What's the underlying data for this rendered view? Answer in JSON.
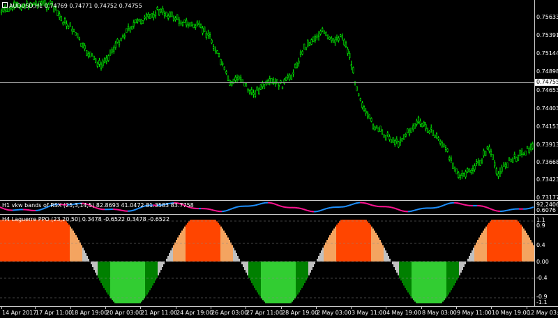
{
  "main_pane": {
    "symbol_title": "AUDUSD,H1",
    "ohlc": "0.74769 0.74771 0.74752 0.74755",
    "price_labels": [
      "0.75633",
      "0.75391",
      "0.75144",
      "0.74898",
      "0.74653",
      "0.74403",
      "0.74153",
      "0.73913",
      "0.73668",
      "0.73423",
      "0.73177"
    ],
    "current_price": "0.74755",
    "candle_color": "#00ff00"
  },
  "rsx_pane": {
    "title": "H1 vkw bands of RSX (25,3,14,5) 82.8693 41.0472 81.3583 83.7758",
    "labels": [
      "92.2406",
      "0.6076"
    ],
    "colors": {
      "up": "#1e90ff",
      "down": "#ff1493"
    }
  },
  "ppo_pane": {
    "title": "H4 Laguerre PPO (23,20,50) 0.3478 -0.6522 0.3478 -0.6522",
    "labels": [
      "1.1",
      "0.9",
      "0.4",
      "0.00",
      "-0.4",
      "-0.9",
      "-1.1"
    ],
    "colors": {
      "strong_up": "#ff4500",
      "up": "#f4a460",
      "neutral": "#c0c0c0",
      "down": "#008000",
      "strong_down": "#32cd32"
    }
  },
  "time_axis": [
    "14 Apr 2017",
    "17 Apr 11:00",
    "18 Apr 19:00",
    "20 Apr 03:00",
    "21 Apr 11:00",
    "24 Apr 19:00",
    "26 Apr 03:00",
    "27 Apr 11:00",
    "28 Apr 19:00",
    "2 May 03:00",
    "3 May 11:00",
    "4 May 19:00",
    "8 May 03:00",
    "9 May 11:00",
    "10 May 19:00",
    "12 May 03:00"
  ],
  "corner_icon": "window-arrow-icon"
}
